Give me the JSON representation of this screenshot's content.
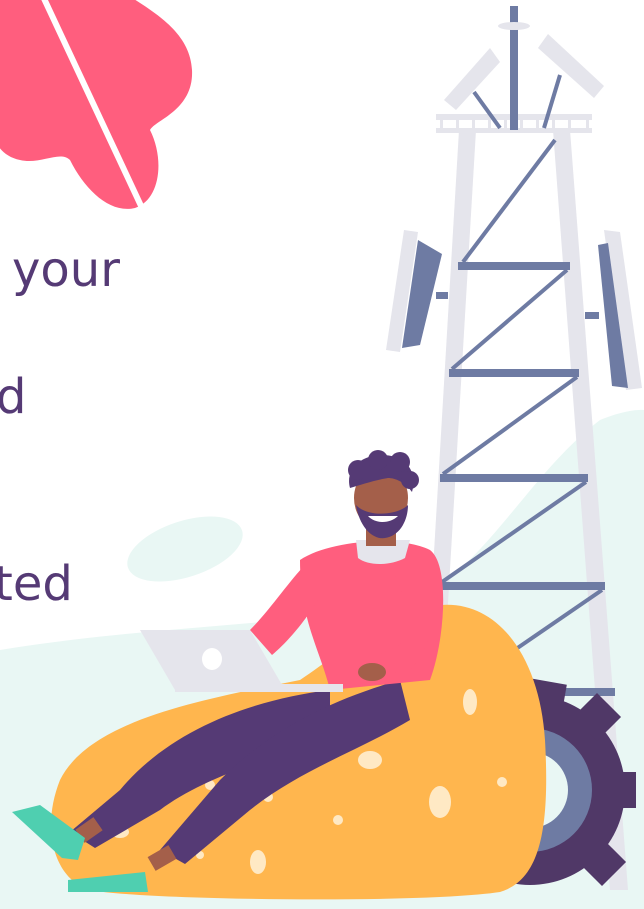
{
  "headline": {
    "line1": "your",
    "line2": "d",
    "line3": "ted"
  },
  "colors": {
    "text_purple": "#553a75",
    "coral": "#ff5e7e",
    "mint_bg": "#e9f7f4",
    "tower_light": "#e5e5ec",
    "tower_blue": "#6e7ba3",
    "beanbag": "#ffb64e",
    "pants": "#553a75",
    "skin": "#a45f4a",
    "shoe": "#4fcfb0",
    "gear": "#503867"
  },
  "icons": [
    "leaf-icon",
    "cell-tower-icon",
    "antenna-panel-icon",
    "laptop-icon",
    "gear-icon",
    "person-illustration"
  ]
}
